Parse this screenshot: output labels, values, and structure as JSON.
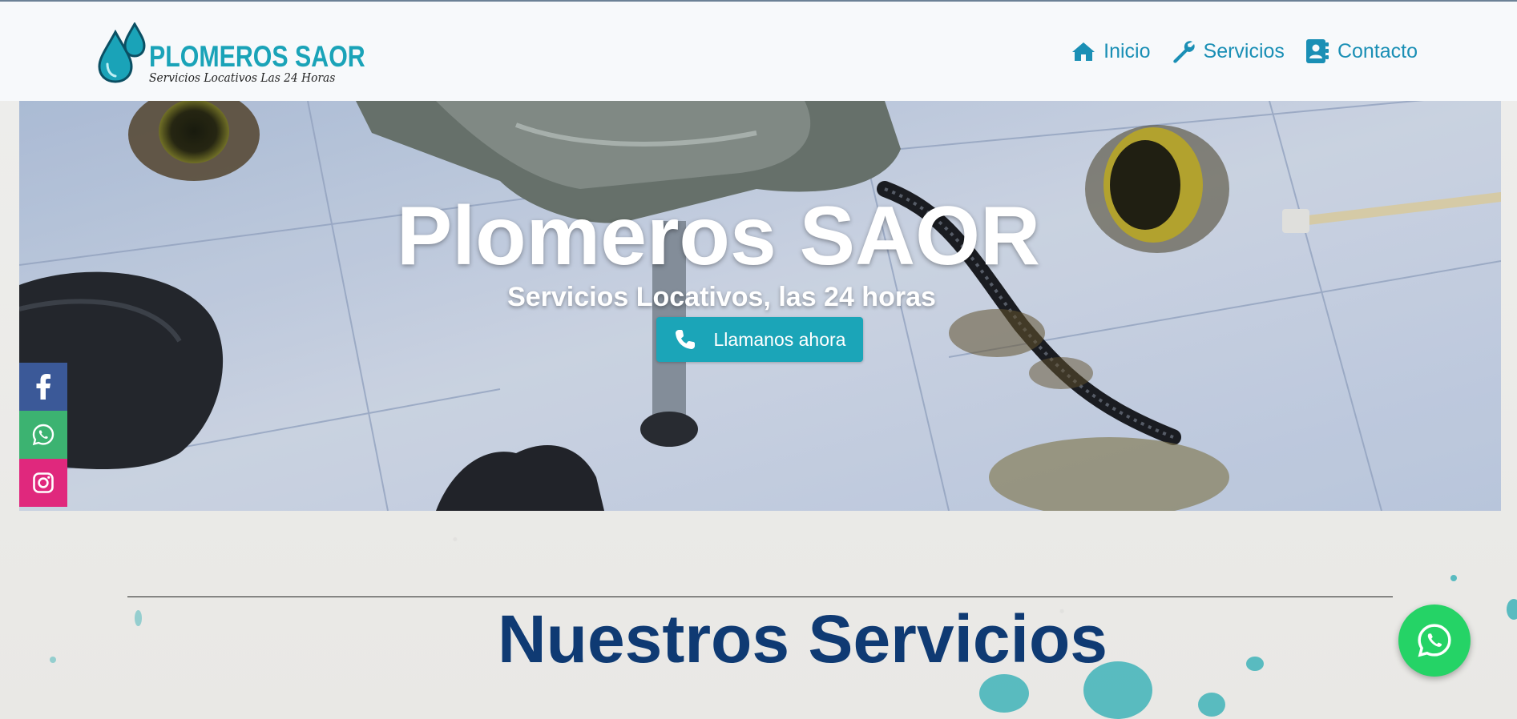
{
  "header": {
    "logo": {
      "name": "PLOMEROS SAOR",
      "tagline": "Servicios Locativos Las 24 Horas"
    },
    "nav": [
      {
        "label": "Inicio",
        "icon": "home-icon"
      },
      {
        "label": "Servicios",
        "icon": "wrench-icon"
      },
      {
        "label": "Contacto",
        "icon": "contact-book-icon"
      }
    ]
  },
  "hero": {
    "title": "Plomeros SAOR",
    "subtitle": "Servicios Locativos, las 24 horas",
    "cta_label": "Llamanos ahora",
    "cta_icon": "phone-icon"
  },
  "social": [
    {
      "name": "facebook",
      "icon": "facebook-icon",
      "color": "#3b5998"
    },
    {
      "name": "whatsapp",
      "icon": "whatsapp-icon",
      "color": "#3cb371"
    },
    {
      "name": "instagram",
      "icon": "instagram-icon",
      "color": "#e0287d"
    }
  ],
  "services": {
    "title": "Nuestros Servicios"
  },
  "whatsapp_float": {
    "icon": "whatsapp-icon",
    "color": "#25d366"
  },
  "colors": {
    "brand": "#1aa3b8",
    "nav_link": "#1a8fb5",
    "heading": "#0f3a73"
  }
}
